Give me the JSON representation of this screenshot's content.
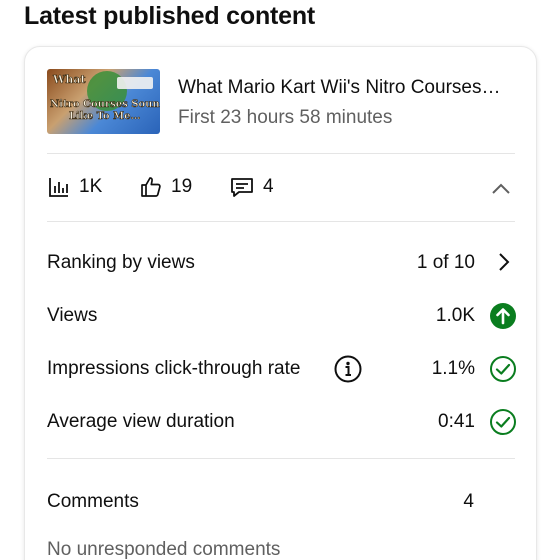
{
  "section_title": "Latest published content",
  "video": {
    "title": "What Mario Kart Wii's Nitro Courses…",
    "subtitle": "First 23 hours 58 minutes",
    "thumbnail_text_1": "What",
    "thumbnail_text_2": "Nitro Courses Sound",
    "thumbnail_text_3": "Like To Me…"
  },
  "stats": {
    "views": "1K",
    "likes": "19",
    "comments": "4"
  },
  "metrics": [
    {
      "label": "Ranking by views",
      "value": "1 of 10",
      "icon": "chevron-right-icon"
    },
    {
      "label": "Views",
      "value": "1.0K",
      "icon": "arrow-up-circle-icon"
    },
    {
      "label": "Impressions click-through rate",
      "value": "1.1%",
      "icon": "check-circle-icon"
    },
    {
      "label": "Average view duration",
      "value": "0:41",
      "icon": "check-circle-icon"
    }
  ],
  "comments_section": {
    "label": "Comments",
    "value": "4",
    "status": "No unresponded comments"
  },
  "colors": {
    "positive_green": "#0a7d1f",
    "text_primary": "#0f0f0f",
    "text_secondary": "#606060"
  }
}
